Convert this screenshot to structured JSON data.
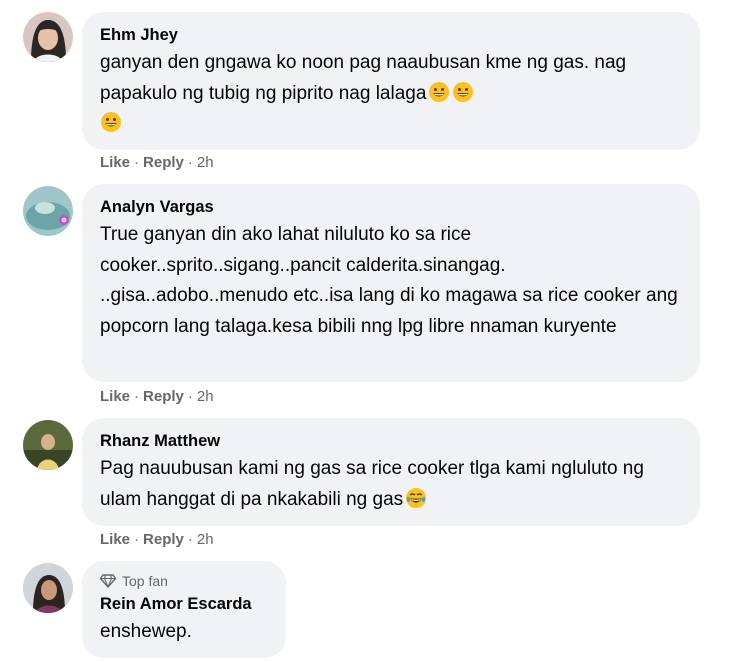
{
  "comments": [
    {
      "name": "Ehm Jhey",
      "text": "ganyan den gngawa ko noon pag naaubusan kme ng gas. nag papakulo ng tubig ng piprito nag lalaga",
      "emojis": [
        "grinning-face-icon",
        "grinning-face-icon",
        "grinning-face-icon"
      ],
      "like": "Like",
      "reply": "Reply",
      "time": "2h"
    },
    {
      "name": "Analyn Vargas",
      "text": "True ganyan din ako lahat niluluto ko sa rice cooker..sprito..sigang..pancit calderita.sinangag. ..gisa..adobo..menudo etc..isa lang di ko magawa sa rice cooker ang popcorn lang talaga.kesa bibili nng lpg libre nnaman kuryente",
      "like": "Like",
      "reply": "Reply",
      "time": "2h"
    },
    {
      "name": "Rhanz Matthew",
      "text": "Pag nauubusan kami ng gas sa rice cooker tlga kami ngluluto ng ulam hanggat di pa nkakabili ng gas",
      "emojis": [
        "tears-of-joy-icon"
      ],
      "like": "Like",
      "reply": "Reply",
      "time": "2h"
    },
    {
      "badge": "Top fan",
      "name": "Rein Amor Escarda",
      "text": "enshewep."
    }
  ],
  "colors": {
    "bubble": "#f0f2f5",
    "name": "#050505",
    "meta": "#65676b"
  }
}
